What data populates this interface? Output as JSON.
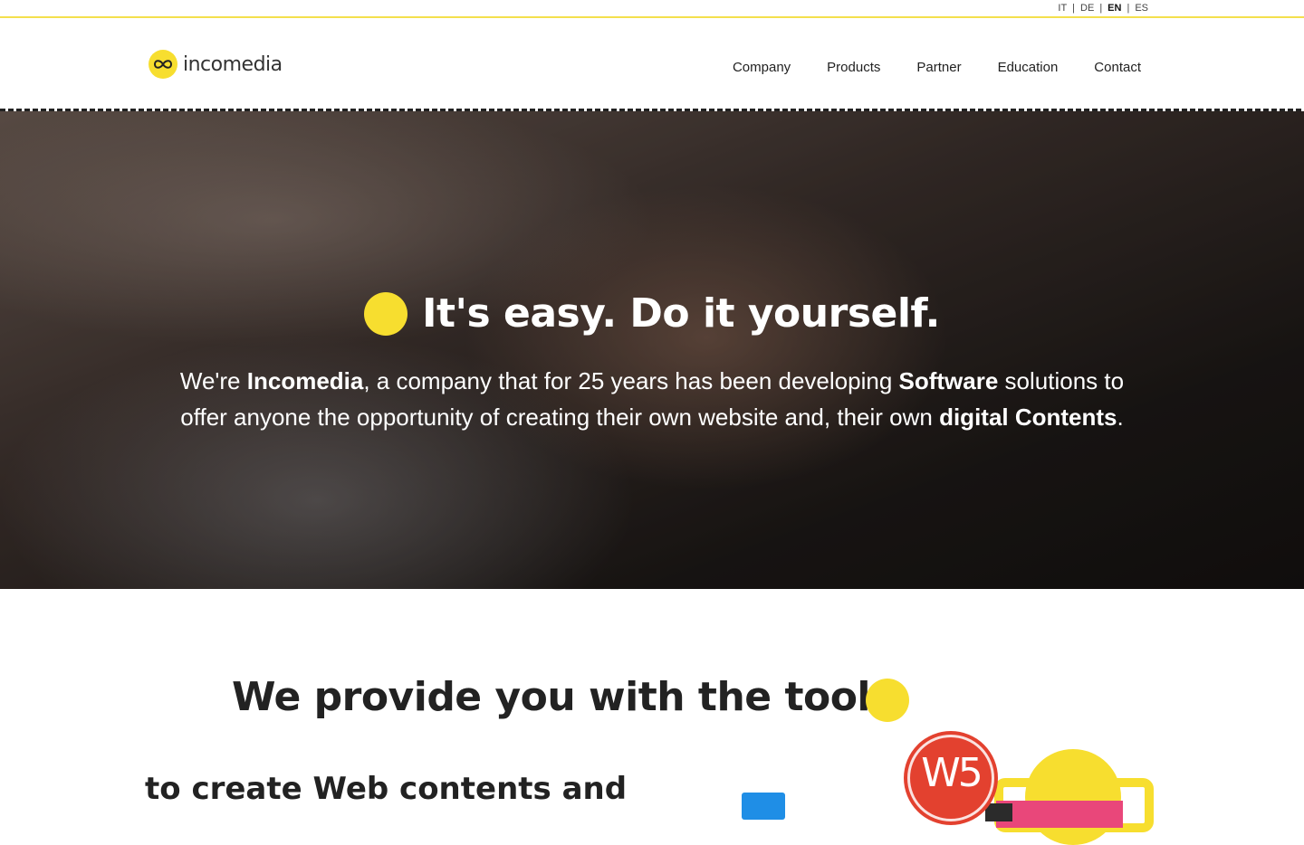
{
  "languages": [
    {
      "code": "IT",
      "active": false
    },
    {
      "code": "DE",
      "active": false
    },
    {
      "code": "EN",
      "active": true
    },
    {
      "code": "ES",
      "active": false
    }
  ],
  "brand": {
    "name": "incomedia",
    "accent_color": "#f7de2f"
  },
  "nav": [
    "Company",
    "Products",
    "Partner",
    "Education",
    "Contact"
  ],
  "hero": {
    "title": "It's easy. Do it yourself.",
    "text": {
      "p1": "We're ",
      "b1": "Incomedia",
      "p2": ", a company that for 25 years has been developing ",
      "b2": "Software",
      "p3": " solutions to offer anyone the opportunity of creating their own website and, their own ",
      "b3": "digital Contents",
      "p4": "."
    }
  },
  "section": {
    "title": "We provide you with the tools",
    "subtitle": "to create Web contents and"
  },
  "illustration": {
    "badge_text": "W5"
  }
}
